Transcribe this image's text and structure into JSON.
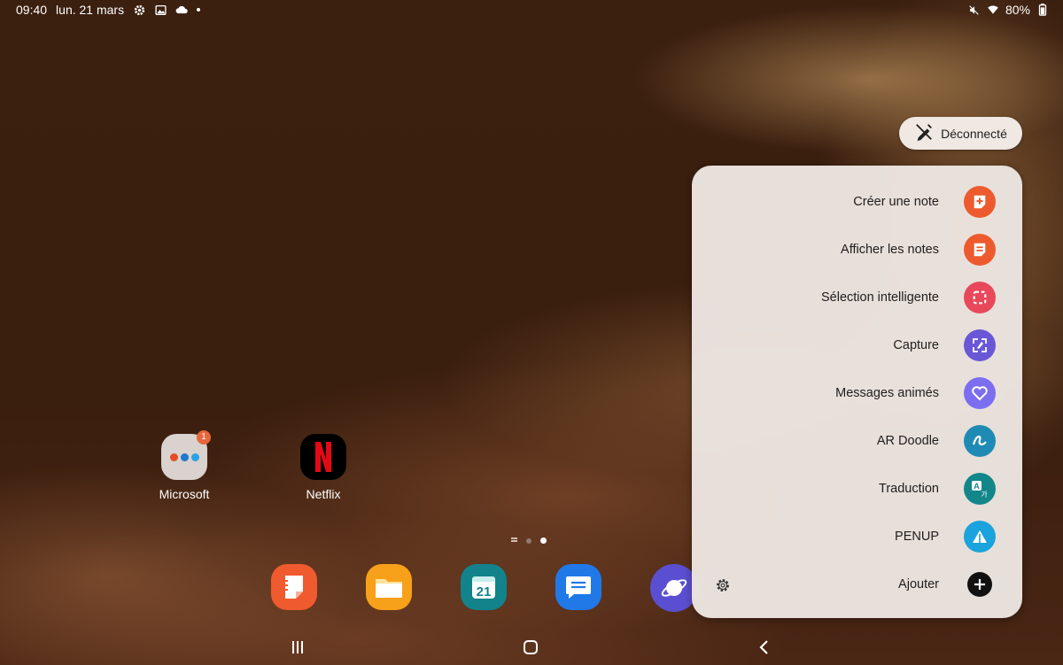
{
  "status_bar": {
    "time": "09:40",
    "date": "lun. 21 mars",
    "left_icons": [
      "gear-icon",
      "image-icon",
      "cloud-icon"
    ],
    "right_icons": [
      "mute-icon",
      "wifi-icon",
      "battery-icon"
    ],
    "battery": "80%"
  },
  "desktop": {
    "apps": [
      {
        "label": "Microsoft",
        "badge": "1",
        "icon": "folder-icon"
      },
      {
        "label": "Netflix",
        "icon": "netflix-icon"
      }
    ]
  },
  "dock": {
    "apps": [
      {
        "icon": "notes-app-icon",
        "color": "#ef5a2f"
      },
      {
        "icon": "files-app-icon",
        "color": "#f7a11b"
      },
      {
        "icon": "calendar-app-icon",
        "color": "#12838b",
        "day": "21"
      },
      {
        "icon": "messages-app-icon",
        "color": "#2179e8"
      },
      {
        "icon": "internet-app-icon",
        "color": "#5b4fd1"
      }
    ]
  },
  "pen_status": {
    "label": "Déconnecté",
    "icon": "spen-disconnected-icon"
  },
  "air_command": {
    "items": [
      {
        "label": "Créer une note",
        "icon": "create-note-icon",
        "color": "#ec5a2e"
      },
      {
        "label": "Afficher les notes",
        "icon": "view-notes-icon",
        "color": "#ec5a2e"
      },
      {
        "label": "Sélection intelligente",
        "icon": "smart-select-icon",
        "color": "#e8485a"
      },
      {
        "label": "Capture",
        "icon": "screen-write-icon",
        "color": "#6a57d6"
      },
      {
        "label": "Messages animés",
        "icon": "live-message-icon",
        "color": "#7b6ef0"
      },
      {
        "label": "AR Doodle",
        "icon": "ar-doodle-icon",
        "color": "#1f8bb5"
      },
      {
        "label": "Traduction",
        "icon": "translate-icon",
        "color": "#13868a"
      },
      {
        "label": "PENUP",
        "icon": "penup-icon",
        "color": "#1aa3dc"
      },
      {
        "label": "Ajouter",
        "icon": "add-icon",
        "color": "#111111"
      }
    ],
    "settings_icon": "settings-icon"
  },
  "nav_bar": {
    "buttons": [
      "recents-icon",
      "home-icon",
      "back-icon"
    ]
  }
}
